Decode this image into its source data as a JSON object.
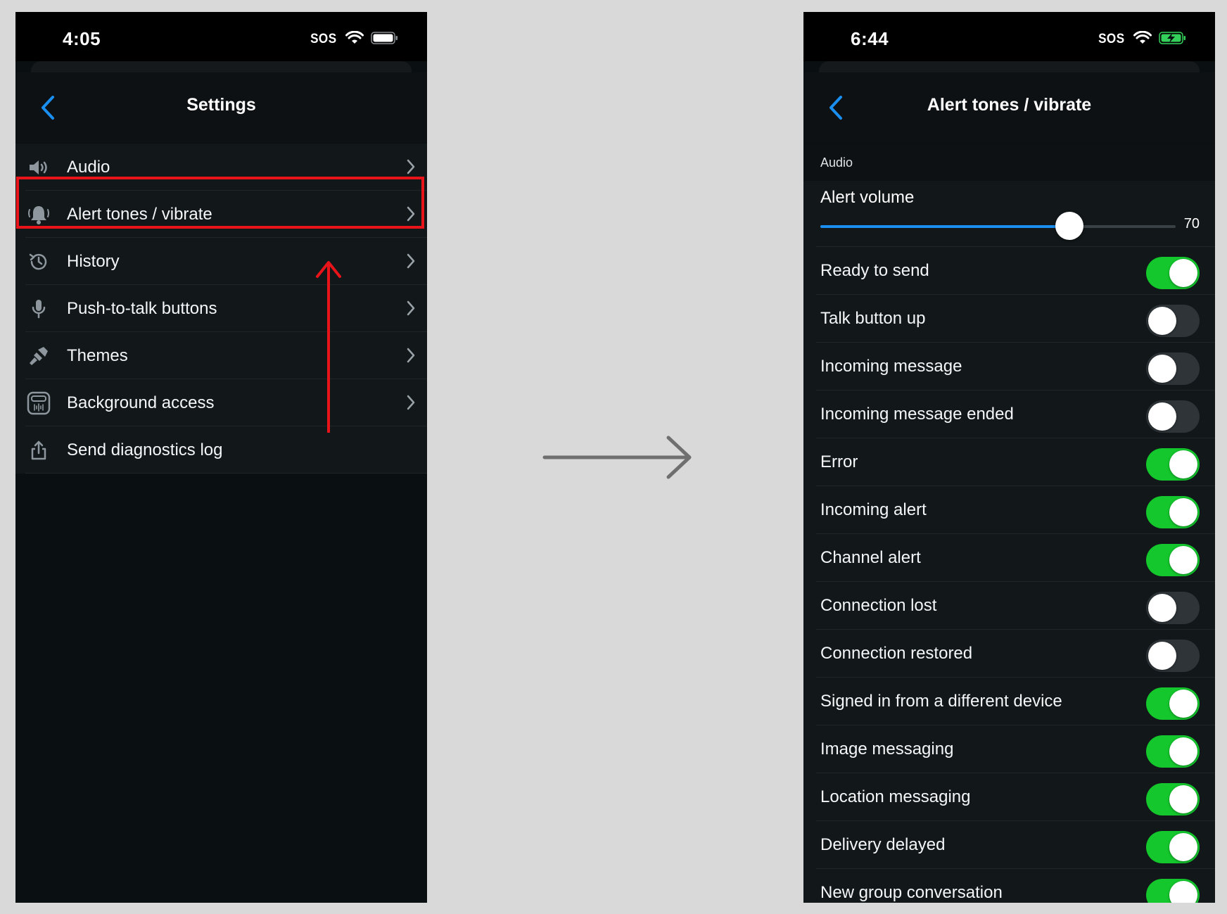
{
  "left_screen": {
    "status": {
      "time": "4:05",
      "sos": "SOS"
    },
    "nav": {
      "title": "Settings"
    },
    "items": [
      {
        "label": "Audio",
        "icon": "speaker-icon",
        "chevron": true
      },
      {
        "label": "Alert tones / vibrate",
        "icon": "bell-icon",
        "chevron": true
      },
      {
        "label": "History",
        "icon": "history-icon",
        "chevron": true
      },
      {
        "label": "Push-to-talk buttons",
        "icon": "microphone-icon",
        "chevron": true
      },
      {
        "label": "Themes",
        "icon": "paintbrush-icon",
        "chevron": true
      },
      {
        "label": "Background access",
        "icon": "background-access-icon",
        "chevron": true
      },
      {
        "label": "Send diagnostics log",
        "icon": "share-icon",
        "chevron": false
      }
    ]
  },
  "right_screen": {
    "status": {
      "time": "6:44",
      "sos": "SOS"
    },
    "nav": {
      "title": "Alert tones / vibrate"
    },
    "section": "Audio",
    "volume": {
      "label": "Alert volume",
      "value": "70",
      "fraction": 0.7
    },
    "toggles": [
      {
        "label": "Ready to send",
        "on": true
      },
      {
        "label": "Talk button up",
        "on": false
      },
      {
        "label": "Incoming message",
        "on": false
      },
      {
        "label": "Incoming message ended",
        "on": false
      },
      {
        "label": "Error",
        "on": true
      },
      {
        "label": "Incoming alert",
        "on": true
      },
      {
        "label": "Channel alert",
        "on": true
      },
      {
        "label": "Connection lost",
        "on": false
      },
      {
        "label": "Connection restored",
        "on": false
      },
      {
        "label": "Signed in from a different device",
        "on": true
      },
      {
        "label": "Image messaging",
        "on": true
      },
      {
        "label": "Location messaging",
        "on": true
      },
      {
        "label": "Delivery delayed",
        "on": true
      },
      {
        "label": "New group conversation",
        "on": true
      }
    ]
  },
  "colors": {
    "accent_blue": "#1b8ff0",
    "toggle_on": "#14c72d",
    "highlight_red": "#e8141a",
    "battery_charging": "#34d15a"
  }
}
